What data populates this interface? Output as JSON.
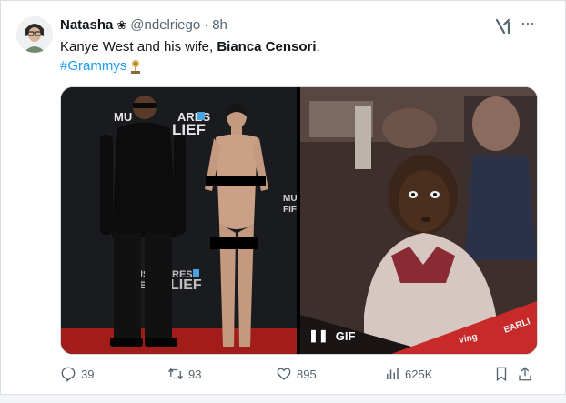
{
  "tweet": {
    "author_name": "Natasha",
    "verified_glyph": "❀",
    "handle": "@ndelriego",
    "separator": "·",
    "time": "8h",
    "text_plain": "Kanye West and his wife, ",
    "text_bold": "Bianca Censori",
    "text_end": ".",
    "hashtag": "#Grammys",
    "hashtag_icon": "grammy-trophy-emoji"
  },
  "media": {
    "left_backdrop_line1a": "MU",
    "left_backdrop_line1b": "ARES",
    "left_backdrop_line2": "LIEF",
    "left_backdrop_line3a": "US",
    "left_backdrop_line3b": "RES",
    "left_backdrop_line4a": "RE",
    "left_backdrop_line4b": "LIEF",
    "left_side_a": "MU",
    "left_side_b": "FIF",
    "gif_label": "GIF",
    "pause_glyph": "❚❚",
    "banner_text_a": "ving",
    "banner_text_b": "EARLI"
  },
  "actions": {
    "replies": "39",
    "reposts": "93",
    "likes": "895",
    "views": "625K"
  },
  "colors": {
    "link": "#1d9bf0",
    "muted": "#536471",
    "text": "#0f1419"
  }
}
